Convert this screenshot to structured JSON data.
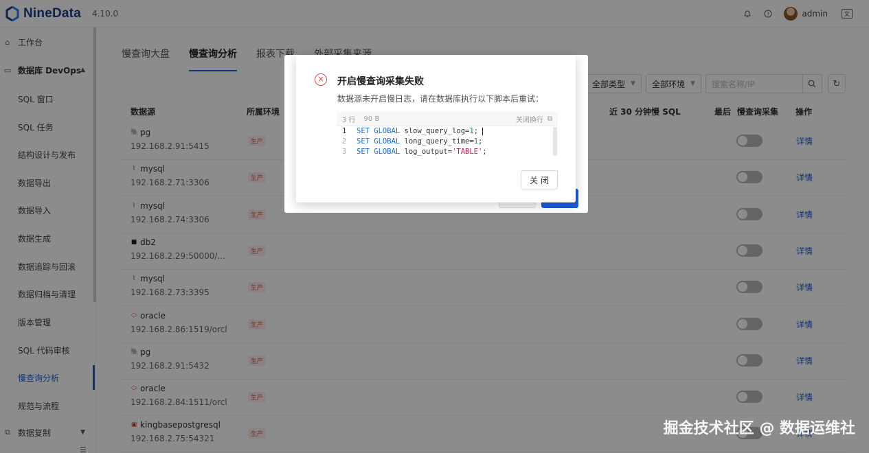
{
  "header": {
    "brand": "NineData",
    "version": "4.10.0",
    "user": "admin"
  },
  "sidebar": {
    "items": [
      {
        "label": "工作台",
        "icon": "home-icon",
        "type": "top"
      },
      {
        "label": "数据库 DevOps",
        "icon": "monitor-icon",
        "type": "group"
      },
      {
        "label": "SQL 窗口",
        "type": "sub"
      },
      {
        "label": "SQL 任务",
        "type": "sub"
      },
      {
        "label": "结构设计与发布",
        "type": "sub"
      },
      {
        "label": "数据导出",
        "type": "sub"
      },
      {
        "label": "数据导入",
        "type": "sub"
      },
      {
        "label": "数据生成",
        "type": "sub"
      },
      {
        "label": "数据追踪与回滚",
        "type": "sub"
      },
      {
        "label": "数据归档与清理",
        "type": "sub"
      },
      {
        "label": "版本管理",
        "type": "sub"
      },
      {
        "label": "SQL 代码审核",
        "type": "sub"
      },
      {
        "label": "慢查询分析",
        "type": "sub",
        "active": true
      },
      {
        "label": "规范与流程",
        "type": "sub"
      },
      {
        "label": "数据复制",
        "icon": "copy-icon",
        "type": "group"
      }
    ]
  },
  "tabs": [
    {
      "label": "慢查询大盘"
    },
    {
      "label": "慢查询分析",
      "active": true
    },
    {
      "label": "报表下载"
    },
    {
      "label": "外部采集来源"
    }
  ],
  "filters": {
    "type": "全部类型",
    "env": "全部环境",
    "search_placeholder": "搜索名称/IP"
  },
  "table": {
    "headers": [
      "数据源",
      "所属环境",
      "近 30 分钟慢 SQL",
      "最后",
      "慢查询采集",
      "操作"
    ],
    "rows": [
      {
        "name": "pg",
        "addr": "192.168.2.91:5415",
        "db": "pg",
        "env": "生产",
        "action": "详情"
      },
      {
        "name": "mysql",
        "addr": "192.168.2.71:3306",
        "db": "mysql",
        "env": "生产",
        "action": "详情"
      },
      {
        "name": "mysql",
        "addr": "192.168.2.74:3306",
        "db": "mysql",
        "env": "生产",
        "action": "详情"
      },
      {
        "name": "db2",
        "addr": "192.168.2.29:50000/...",
        "db": "db2",
        "env": "生产",
        "action": "详情"
      },
      {
        "name": "mysql",
        "addr": "192.168.2.73:3395",
        "db": "mysql",
        "env": "生产",
        "action": "详情"
      },
      {
        "name": "oracle",
        "addr": "192.168.2.86:1519/orcl",
        "db": "oracle",
        "env": "生产",
        "action": "详情"
      },
      {
        "name": "pg",
        "addr": "192.168.2.91:5432",
        "db": "pg",
        "env": "生产",
        "action": "详情"
      },
      {
        "name": "oracle",
        "addr": "192.168.2.84:1511/orcl",
        "db": "oracle",
        "env": "生产",
        "action": "详情"
      },
      {
        "name": "kingbasepostgresql",
        "addr": "192.168.2.75:54321",
        "db": "kingbase",
        "env": "生产",
        "action": "详情"
      }
    ]
  },
  "dialog": {
    "title": "开启慢查询采集失败",
    "message": "数据源未开启慢日志，请在数据库执行以下脚本后重试：",
    "code_meta": {
      "lines": "3 行",
      "size": "90 B",
      "wrap": "关闭换行"
    },
    "code_lines": [
      {
        "n": "1",
        "parts": [
          [
            "kw",
            "SET GLOBAL"
          ],
          [
            "t",
            " slow_query_log="
          ],
          [
            "num",
            "1"
          ],
          [
            "t",
            ";"
          ]
        ]
      },
      {
        "n": "2",
        "parts": [
          [
            "kw",
            "SET GLOBAL"
          ],
          [
            "t",
            " long_query_time="
          ],
          [
            "num",
            "1"
          ],
          [
            "t",
            ";"
          ]
        ]
      },
      {
        "n": "3",
        "parts": [
          [
            "kw",
            "SET GLOBAL"
          ],
          [
            "t",
            " log_output="
          ],
          [
            "str",
            "'TABLE'"
          ],
          [
            "t",
            ";"
          ]
        ]
      }
    ],
    "close_label": "关闭"
  },
  "watermark": "掘金技术社区 @ 数据运维社",
  "colors": {
    "accent": "#1c5bd9",
    "error": "#e5484d",
    "brand": "#1c3e8a"
  }
}
